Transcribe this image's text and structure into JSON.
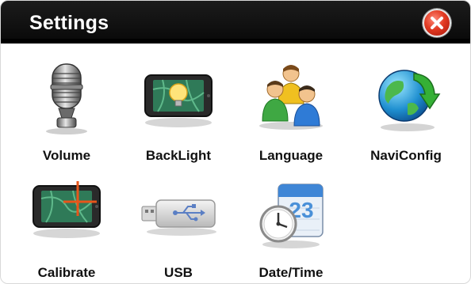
{
  "window": {
    "title": "Settings",
    "close_icon": "close-icon"
  },
  "colors": {
    "titlebar": "#0b0b0b",
    "title_text": "#ffffff",
    "close_red": "#e23a22",
    "label_text": "#111111"
  },
  "items": [
    {
      "label": "Volume",
      "icon": "microphone-icon"
    },
    {
      "label": "BackLight",
      "icon": "backlight-icon"
    },
    {
      "label": "Language",
      "icon": "people-icon"
    },
    {
      "label": "NaviConfig",
      "icon": "globe-icon"
    },
    {
      "label": "Calibrate",
      "icon": "calibrate-icon"
    },
    {
      "label": "USB",
      "icon": "usb-icon"
    },
    {
      "label": "Date/Time",
      "icon": "calendar-clock-icon"
    }
  ]
}
